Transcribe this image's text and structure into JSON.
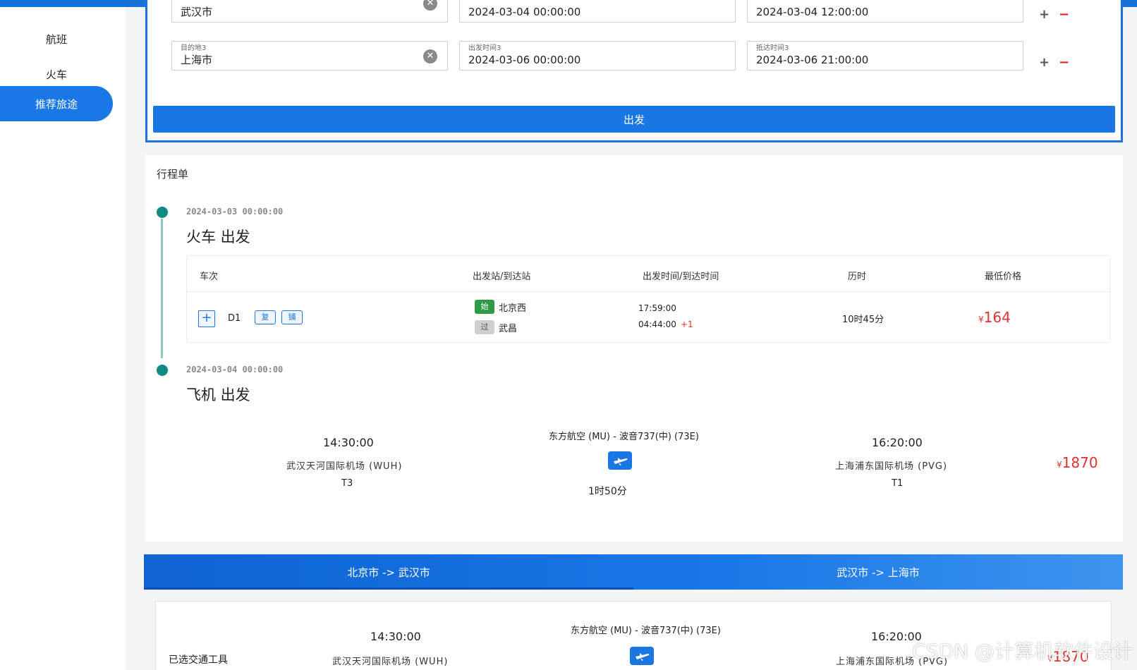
{
  "sidebar": {
    "items": [
      {
        "label": "航班",
        "active": false
      },
      {
        "label": "火车",
        "active": false
      },
      {
        "label": "推荐旅途",
        "active": true
      }
    ]
  },
  "trip_form": {
    "rows": [
      {
        "origin_label": "",
        "origin_value": "武汉市",
        "depart_label": "",
        "depart_value": "2024-03-04 00:00:00",
        "arrive_label": "",
        "arrive_value": "2024-03-04 12:00:00"
      },
      {
        "origin_label": "目的地3",
        "origin_value": "上海市",
        "depart_label": "出发时间3",
        "depart_value": "2024-03-06 00:00:00",
        "arrive_label": "抵达时间3",
        "arrive_value": "2024-03-06 21:00:00"
      }
    ],
    "add_label": "+",
    "remove_label": "−",
    "submit_label": "出发"
  },
  "itinerary": {
    "title": "行程单",
    "train": {
      "time": "2024-03-03 00:00:00",
      "title": "火车 出发",
      "headers": [
        "车次",
        "出发站/到达站",
        "出发时间/到达时间",
        "历时",
        "最低价格"
      ],
      "row": {
        "expand_label": "+",
        "number": "D1",
        "tag1": "复",
        "tag2": "铺",
        "from_badge": "始",
        "from_station": "北京西",
        "to_badge": "过",
        "to_station": "武昌",
        "depart_time": "17:59:00",
        "arrive_time": "04:44:00",
        "day_offset": "+1",
        "duration": "10时45分",
        "currency": "¥",
        "price": "164"
      }
    },
    "flight": {
      "time": "2024-03-04 00:00:00",
      "title": "飞机 出发",
      "depart_time": "14:30:00",
      "depart_airport": "武汉天河国际机场 (WUH)",
      "depart_terminal": "T3",
      "airline": "东方航空 (MU) - 波音737(中) (73E)",
      "duration": "1时50分",
      "arrive_time": "16:20:00",
      "arrive_airport": "上海浦东国际机场 (PVG)",
      "arrive_terminal": "T1",
      "currency": "¥",
      "price": "1870"
    }
  },
  "tabs": [
    {
      "label": "北京市 -> 武汉市",
      "active": true
    },
    {
      "label": "武汉市 -> 上海市",
      "active": false
    }
  ],
  "selected": {
    "label": "已选交通工具",
    "depart_time": "14:30:00",
    "depart_airport": "武汉天河国际机场 (WUH)",
    "airline": "东方航空 (MU) - 波音737(中) (73E)",
    "arrive_time": "16:20:00",
    "arrive_airport": "上海浦东国际机场 (PVG)",
    "currency": "¥",
    "price": "1870"
  },
  "watermark": "CSDN @计算机软件设计",
  "colors": {
    "accent": "#1a76e2",
    "price": "#e0302f",
    "timeline": "#0f8a82"
  }
}
